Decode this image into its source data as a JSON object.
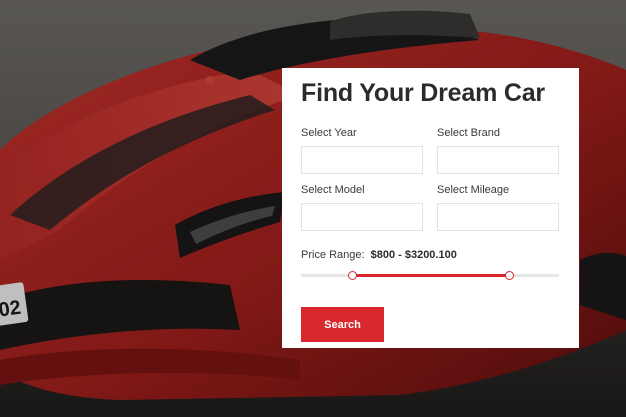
{
  "hero": {
    "photo": "red-sports-car"
  },
  "form": {
    "title": "Find Your Dream Car",
    "fields": [
      {
        "label": "Select Year",
        "value": ""
      },
      {
        "label": "Select Brand",
        "value": ""
      },
      {
        "label": "Select Model",
        "value": ""
      },
      {
        "label": "Select Mileage",
        "value": ""
      }
    ],
    "price": {
      "label": "Price Range:",
      "value_text": "$800 - $3200.100",
      "range_low": 0.2,
      "range_high": 0.81
    },
    "search_label": "Search"
  },
  "colors": {
    "accent": "#d8282e",
    "title": "#2b2b2b",
    "card": "#ffffff"
  }
}
